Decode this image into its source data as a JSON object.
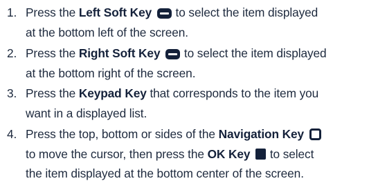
{
  "steps": [
    {
      "number": "1.",
      "lines": [
        {
          "parts": {
            "a": "Press the ",
            "b": "Left Soft Key",
            "c": "to select the item displayed"
          }
        },
        {
          "text": "at the bottom left of the screen."
        }
      ],
      "icon": "soft-key-icon"
    },
    {
      "number": "2.",
      "lines": [
        {
          "parts": {
            "a": "Press the ",
            "b": "Right Soft Key",
            "c": "to select the item displayed"
          }
        },
        {
          "text": "at the bottom right of the screen."
        }
      ],
      "icon": "soft-key-icon"
    },
    {
      "number": "3.",
      "lines": [
        {
          "parts": {
            "a": "Press the ",
            "b": "Keypad Key",
            "c": " that corresponds to the item you"
          }
        },
        {
          "text": "want in a displayed list."
        }
      ]
    },
    {
      "number": "4.",
      "lines": [
        {
          "parts": {
            "a": "Press the top, bottom or sides of the ",
            "b": "Navigation Key"
          }
        },
        {
          "parts": {
            "a": "to move the cursor, then press the ",
            "b": "OK Key",
            "c": "to select"
          }
        },
        {
          "text": "the item displayed at the bottom center of the screen."
        }
      ],
      "icons": [
        "navigation-key-icon",
        "ok-key-icon"
      ]
    }
  ],
  "colors": {
    "text": "#1e2a3e",
    "bold": "#14213a",
    "background": "#ffffff"
  }
}
